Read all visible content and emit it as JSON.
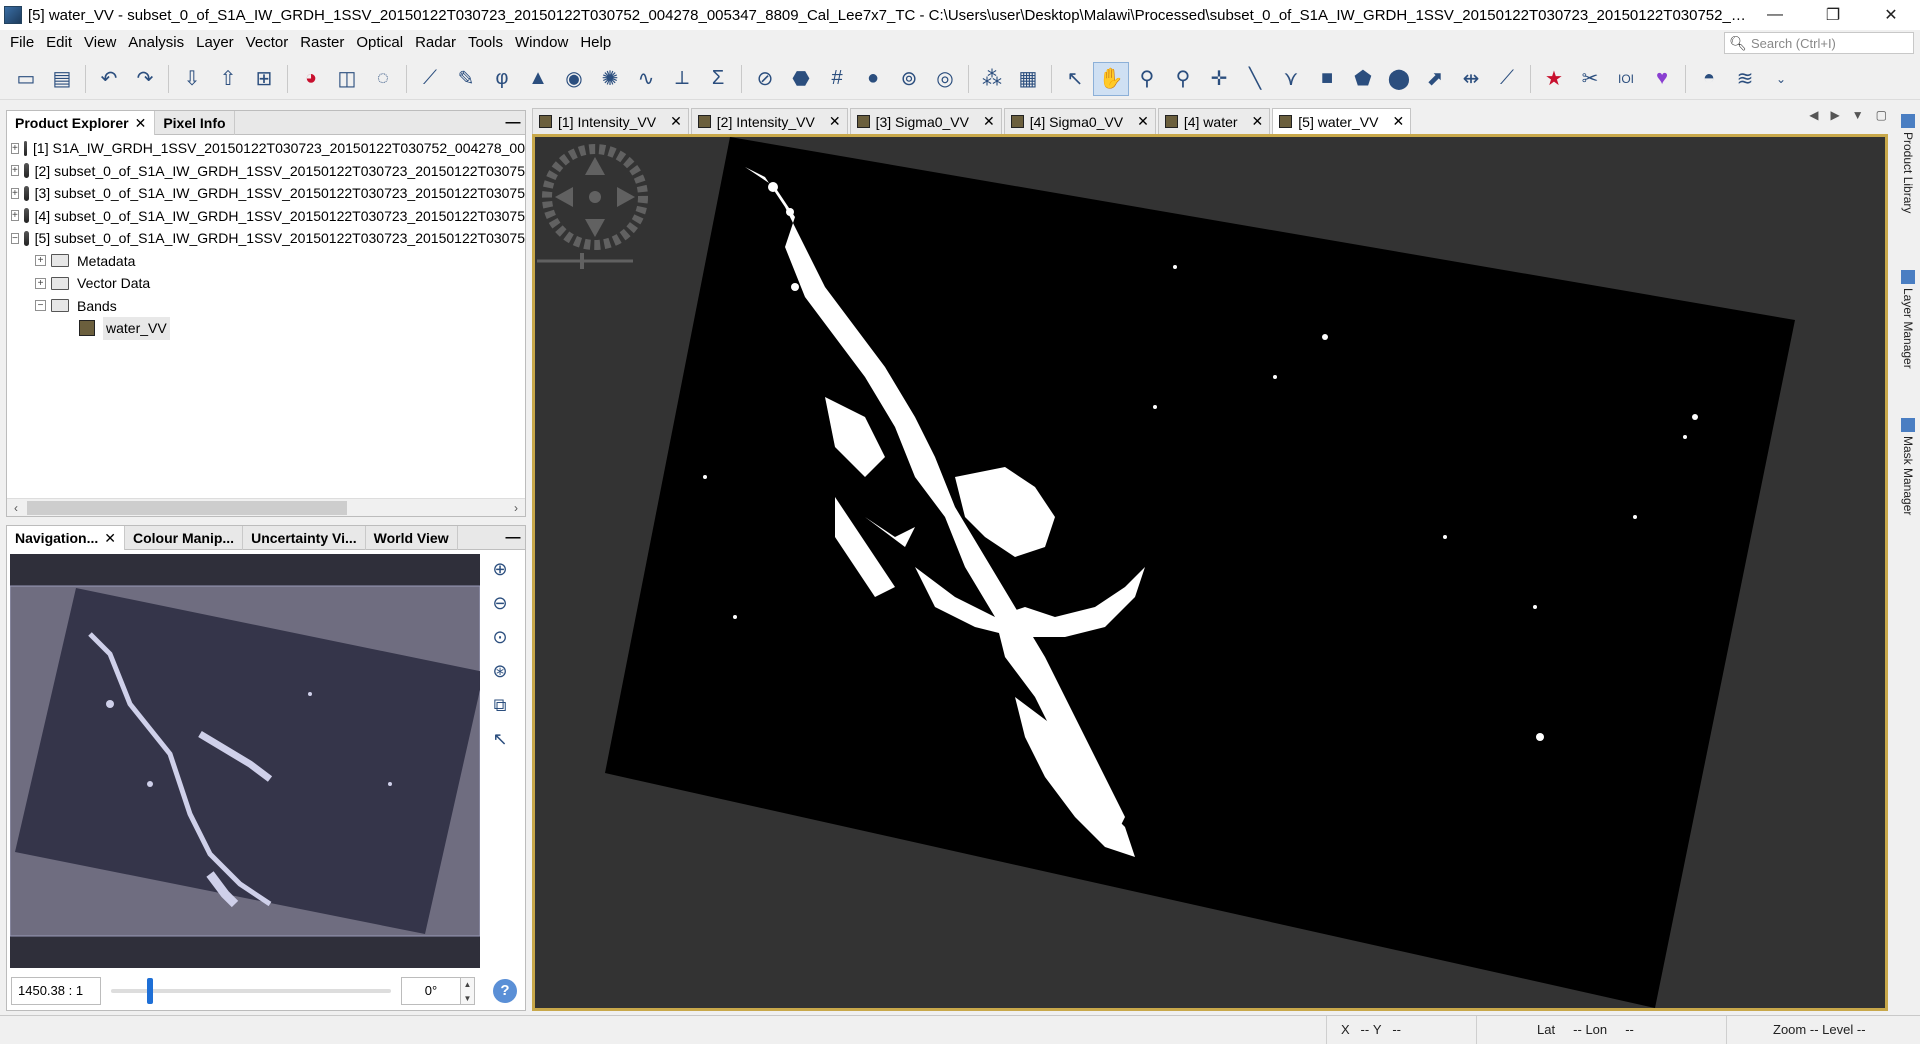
{
  "window": {
    "title": "[5] water_VV - subset_0_of_S1A_IW_GRDH_1SSV_20150122T030723_20150122T030752_004278_005347_8809_Cal_Lee7x7_TC - C:\\Users\\user\\Desktop\\Malawi\\Processed\\subset_0_of_S1A_IW_GRDH_1SSV_20150122T030723_20150122T030752_004278_005347_8...",
    "minimize": "—",
    "restore": "❐",
    "close": "✕"
  },
  "menu": [
    "File",
    "Edit",
    "View",
    "Analysis",
    "Layer",
    "Vector",
    "Raster",
    "Optical",
    "Radar",
    "Tools",
    "Window",
    "Help"
  ],
  "search": {
    "placeholder": "Search (Ctrl+I)"
  },
  "product_explorer": {
    "tabs": [
      "Product Explorer",
      "Pixel Info"
    ],
    "minimize": "—",
    "products": [
      "[1] S1A_IW_GRDH_1SSV_20150122T030723_20150122T030752_004278_00",
      "[2] subset_0_of_S1A_IW_GRDH_1SSV_20150122T030723_20150122T03075",
      "[3] subset_0_of_S1A_IW_GRDH_1SSV_20150122T030723_20150122T03075",
      "[4] subset_0_of_S1A_IW_GRDH_1SSV_20150122T030723_20150122T03075",
      "[5] subset_0_of_S1A_IW_GRDH_1SSV_20150122T030723_20150122T03075"
    ],
    "nodes": [
      "Metadata",
      "Vector Data",
      "Bands"
    ],
    "band": "water_VV"
  },
  "navigation_panel": {
    "tabs": [
      "Navigation...",
      "Colour Manip...",
      "Uncertainty Vi...",
      "World View"
    ],
    "scale": "1450.38 : 1",
    "angle": "0°",
    "help": "?"
  },
  "doc_tabs": [
    "[1] Intensity_VV",
    "[2] Intensity_VV",
    "[3] Sigma0_VV",
    "[4] Sigma0_VV",
    "[4] water",
    "[5] water_VV"
  ],
  "right_dock": [
    "Product Library",
    "Layer Manager",
    "Mask Manager"
  ],
  "status": {
    "x_label": "X",
    "x_value": "--",
    "y_label": "Y",
    "y_value": "--",
    "lat_label": "Lat",
    "lat_value": "--",
    "lon_label": "Lon",
    "lon_value": "--",
    "zoom_label": "Zoom",
    "zoom_value": "--",
    "level_label": "Level",
    "level_value": "--"
  },
  "colors": {
    "image_frame": "#c8a84a",
    "viewer_bg": "#333333",
    "water": "#ffffff"
  }
}
